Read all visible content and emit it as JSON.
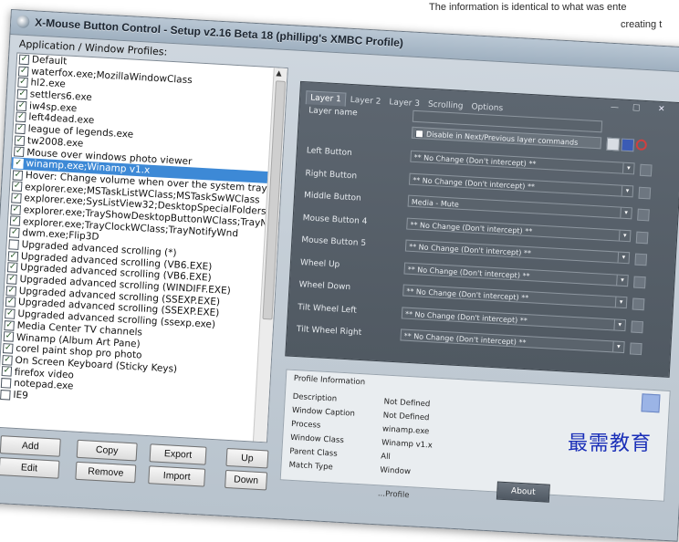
{
  "top_note": {
    "line1": "The information is identical to what was ente",
    "line2": "creating t"
  },
  "window": {
    "title": "X-Mouse Button Control - Setup v2.16 Beta 18 (phillipg's XMBC Profile)"
  },
  "profiles": {
    "label": "Application / Window Profiles:",
    "items": [
      {
        "label": "Default",
        "checked": true,
        "selected": false
      },
      {
        "label": "waterfox.exe;MozillaWindowClass",
        "checked": true,
        "selected": false
      },
      {
        "label": "hl2.exe",
        "checked": true,
        "selected": false
      },
      {
        "label": "settlers6.exe",
        "checked": true,
        "selected": false
      },
      {
        "label": "iw4sp.exe",
        "checked": true,
        "selected": false
      },
      {
        "label": "left4dead.exe",
        "checked": true,
        "selected": false
      },
      {
        "label": "league of legends.exe",
        "checked": true,
        "selected": false
      },
      {
        "label": "tw2008.exe",
        "checked": true,
        "selected": false
      },
      {
        "label": "Mouse over windows photo viewer",
        "checked": true,
        "selected": false
      },
      {
        "label": "winamp.exe;Winamp v1.x",
        "checked": true,
        "selected": true
      },
      {
        "label": "Hover: Change volume when over the system tray",
        "checked": true,
        "selected": false
      },
      {
        "label": "explorer.exe;MSTaskListWClass;MSTaskSwWClass",
        "checked": true,
        "selected": false
      },
      {
        "label": "explorer.exe;SysListView32;DesktopSpecialFolders",
        "checked": true,
        "selected": false
      },
      {
        "label": "explorer.exe;TrayShowDesktopButtonWClass;TrayNotifyWnd",
        "checked": true,
        "selected": false
      },
      {
        "label": "explorer.exe;TrayClockWClass;TrayNotifyWnd",
        "checked": true,
        "selected": false
      },
      {
        "label": "dwm.exe;Flip3D",
        "checked": true,
        "selected": false
      },
      {
        "label": "Upgraded advanced scrolling (*)",
        "checked": false,
        "selected": false
      },
      {
        "label": "Upgraded advanced scrolling (VB6.EXE)",
        "checked": true,
        "selected": false
      },
      {
        "label": "Upgraded advanced scrolling (VB6.EXE)",
        "checked": true,
        "selected": false
      },
      {
        "label": "Upgraded advanced scrolling (WINDIFF.EXE)",
        "checked": true,
        "selected": false
      },
      {
        "label": "Upgraded advanced scrolling (SSEXP.EXE)",
        "checked": true,
        "selected": false
      },
      {
        "label": "Upgraded advanced scrolling (SSEXP.EXE)",
        "checked": true,
        "selected": false
      },
      {
        "label": "Upgraded advanced scrolling (ssexp.exe)",
        "checked": true,
        "selected": false
      },
      {
        "label": "Media Center TV channels",
        "checked": true,
        "selected": false
      },
      {
        "label": "Winamp (Album Art Pane)",
        "checked": true,
        "selected": false
      },
      {
        "label": "corel paint shop pro photo",
        "checked": true,
        "selected": false
      },
      {
        "label": "On Screen Keyboard (Sticky Keys)",
        "checked": true,
        "selected": false
      },
      {
        "label": "firefox video",
        "checked": true,
        "selected": false
      },
      {
        "label": "notepad.exe",
        "checked": false,
        "selected": false
      },
      {
        "label": "IE9",
        "checked": false,
        "selected": false
      }
    ]
  },
  "buttons": {
    "add": "Add",
    "copy": "Copy",
    "export": "Export",
    "up": "Up",
    "edit": "Edit",
    "remove": "Remove",
    "import": "Import",
    "down": "Down"
  },
  "tabs": [
    "Layer 1",
    "Layer 2",
    "Layer 3",
    "Scrolling",
    "Options"
  ],
  "layer": {
    "layer_name_label": "Layer name",
    "disable_label": "Disable in Next/Previous layer commands",
    "fields": [
      {
        "label": "Left Button",
        "value": "** No Change (Don't intercept) **"
      },
      {
        "label": "Right Button",
        "value": "** No Change (Don't intercept) **"
      },
      {
        "label": "Middle Button",
        "value": "Media - Mute"
      },
      {
        "label": "Mouse Button 4",
        "value": "** No Change (Don't intercept) **"
      },
      {
        "label": "Mouse Button 5",
        "value": "** No Change (Don't intercept) **"
      },
      {
        "label": "Wheel Up",
        "value": "** No Change (Don't intercept) **"
      },
      {
        "label": "Wheel Down",
        "value": "** No Change (Don't intercept) **"
      },
      {
        "label": "Tilt Wheel Left",
        "value": "** No Change (Don't intercept) **"
      },
      {
        "label": "Tilt Wheel Right",
        "value": "** No Change (Don't intercept) **"
      }
    ]
  },
  "profile_info": {
    "heading": "Profile Information",
    "rows": [
      {
        "label": "Description",
        "value": "Not Defined"
      },
      {
        "label": "Window Caption",
        "value": "Not Defined"
      },
      {
        "label": "Process",
        "value": "winamp.exe"
      },
      {
        "label": "Window Class",
        "value": "Winamp v1.x"
      },
      {
        "label": "Parent Class",
        "value": "All"
      },
      {
        "label": "Match Type",
        "value": "Window"
      }
    ]
  },
  "bottom": {
    "about": "About",
    "profile_status": "...Profile"
  },
  "watermark": "最需教育",
  "colors": {
    "selection": "#3d89d6",
    "panel": "#505962",
    "watermark": "#1a2fb8"
  }
}
